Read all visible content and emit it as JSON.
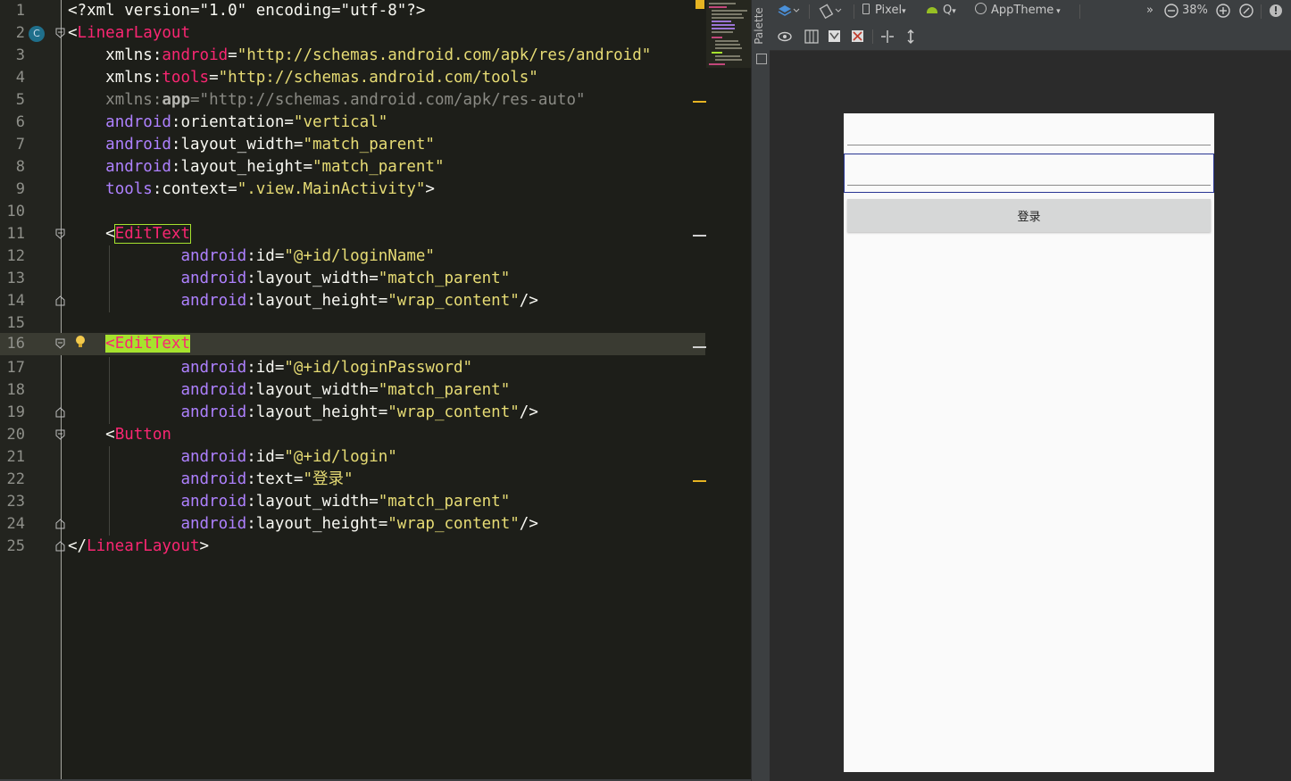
{
  "editor": {
    "lines": [
      {
        "n": "1"
      },
      {
        "n": "2"
      },
      {
        "n": "3"
      },
      {
        "n": "4"
      },
      {
        "n": "5"
      },
      {
        "n": "6"
      },
      {
        "n": "7"
      },
      {
        "n": "8"
      },
      {
        "n": "9"
      },
      {
        "n": "10"
      },
      {
        "n": "11"
      },
      {
        "n": "12"
      },
      {
        "n": "13"
      },
      {
        "n": "14"
      },
      {
        "n": "15"
      },
      {
        "n": "16"
      },
      {
        "n": "17"
      },
      {
        "n": "18"
      },
      {
        "n": "19"
      },
      {
        "n": "20"
      },
      {
        "n": "21"
      },
      {
        "n": "22"
      },
      {
        "n": "23"
      },
      {
        "n": "24"
      },
      {
        "n": "25"
      }
    ],
    "code": {
      "l1": "<?xml version=\"1.0\" encoding=\"utf-8\"?>",
      "l2_tag": "LinearLayout",
      "l3_ns": "android",
      "l3_val": "\"http://schemas.android.com/apk/res/android\"",
      "l4_ns": "tools",
      "l4_val": "\"http://schemas.android.com/tools\"",
      "l5_ns": "app",
      "l5_val": "\"http://schemas.android.com/apk/res-auto\"",
      "l6_attr": "orientation",
      "l6_val": "\"vertical\"",
      "l7_attr": "layout_width",
      "l7_val": "\"match_parent\"",
      "l8_attr": "layout_height",
      "l8_val": "\"match_parent\"",
      "l9_attr": "context",
      "l9_val": "\".view.MainActivity\"",
      "l11_tag": "EditText",
      "l12_attr": "id",
      "l12_val": "\"@+id/loginName\"",
      "l13_attr": "layout_width",
      "l13_val": "\"match_parent\"",
      "l14_attr": "layout_height",
      "l14_val": "\"wrap_content\"",
      "l16_tag": "EditText",
      "l17_attr": "id",
      "l17_val": "\"@+id/loginPassword\"",
      "l18_attr": "layout_width",
      "l18_val": "\"match_parent\"",
      "l19_attr": "layout_height",
      "l19_val": "\"wrap_content\"",
      "l20_tag": "Button",
      "l21_attr": "id",
      "l21_val": "\"@+id/login\"",
      "l22_attr": "text",
      "l22_val": "\"登录\"",
      "l23_attr": "layout_width",
      "l23_val": "\"match_parent\"",
      "l24_attr": "layout_height",
      "l24_val": "\"wrap_content\"",
      "l25_tag": "LinearLayout",
      "ns_android": "android",
      "ns_tools": "tools",
      "xmlns": "xmlns"
    },
    "current_line": "16"
  },
  "side_panel": {
    "palette_label": "Palette"
  },
  "designer": {
    "toolbar": {
      "device": "Pixel",
      "api": "Q",
      "theme": "AppTheme",
      "zoom": "38%",
      "more": "»"
    },
    "preview": {
      "button_text": "登录"
    }
  },
  "colors": {
    "tag": "#f92672",
    "attribute": "#a6e22e",
    "namespace": "#ae81ff",
    "string": "#e6db74",
    "selection_border": "#283593"
  }
}
